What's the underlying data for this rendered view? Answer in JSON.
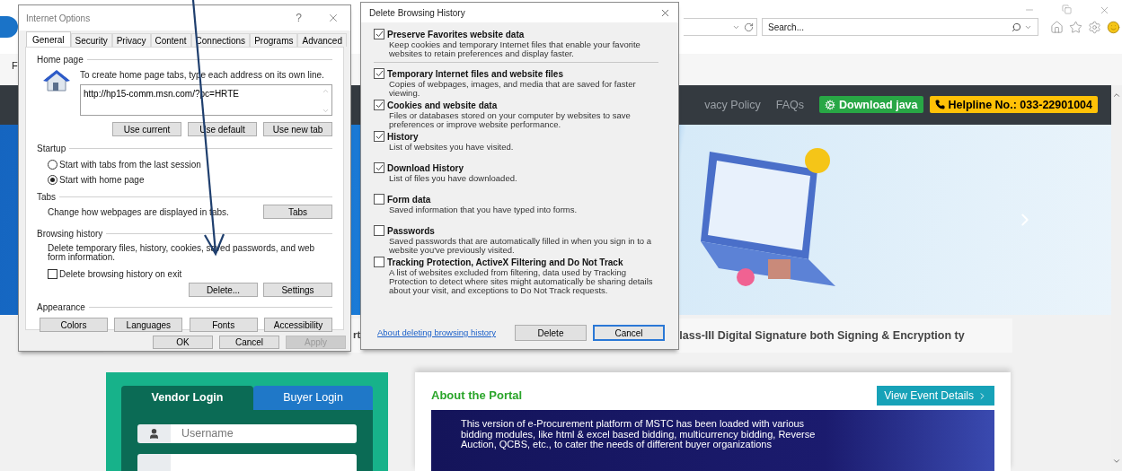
{
  "browser": {
    "search": {
      "placeholder": "Search..."
    },
    "menu_fragment": "F",
    "nav": {
      "links": [
        "vacy Policy",
        "FAQs"
      ],
      "buttons": [
        {
          "kind": "java",
          "label": "Download java"
        },
        {
          "kind": "helpline",
          "label": "Helpline No.: 033-22901004"
        }
      ]
    },
    "marquee": {
      "left": "rt",
      "right": "lass-III Digital Signature both Signing & Encryption ty"
    },
    "login": {
      "tabs": [
        {
          "label": "Vendor Login",
          "selected": true
        },
        {
          "label": "Buyer Login",
          "selected": false
        }
      ],
      "username": {
        "placeholder": "Username"
      }
    },
    "about": {
      "title": "About the Portal",
      "button": "View Event Details",
      "text": "This version of e-Procurement platform of MSTC has been loaded with various bidding modules, like html & excel based bidding, multicurrency bidding, Reverse Auction, QCBS, etc., to cater the needs of different buyer organizations"
    }
  },
  "internet_options": {
    "title": "Internet Options",
    "help": "?",
    "tabs": [
      {
        "label": "General",
        "selected": true
      },
      {
        "label": "Security",
        "selected": false
      },
      {
        "label": "Privacy",
        "selected": false
      },
      {
        "label": "Content",
        "selected": false
      },
      {
        "label": "Connections",
        "selected": false
      },
      {
        "label": "Programs",
        "selected": false
      },
      {
        "label": "Advanced",
        "selected": false
      }
    ],
    "home_page": {
      "label": "Home page",
      "instruction": "To create home page tabs, type each address on its own line.",
      "url": "http://hp15-comm.msn.com/?pc=HRTE",
      "buttons": [
        "Use current",
        "Use default",
        "Use new tab"
      ]
    },
    "startup": {
      "label": "Startup",
      "options": [
        {
          "label": "Start with tabs from the last session",
          "selected": false
        },
        {
          "label": "Start with home page",
          "selected": true
        }
      ]
    },
    "tabs_section": {
      "label": "Tabs",
      "text": "Change how webpages are displayed in tabs.",
      "button": "Tabs"
    },
    "browsing_history": {
      "label": "Browsing history",
      "text": "Delete temporary files, history, cookies, saved passwords, and web form information.",
      "checkbox": {
        "label": "Delete browsing history on exit",
        "checked": false
      },
      "buttons": [
        "Delete...",
        "Settings"
      ]
    },
    "appearance": {
      "label": "Appearance",
      "buttons": [
        "Colors",
        "Languages",
        "Fonts",
        "Accessibility"
      ]
    },
    "footer": [
      {
        "label": "OK",
        "disabled": false
      },
      {
        "label": "Cancel",
        "disabled": false
      },
      {
        "label": "Apply",
        "disabled": true
      }
    ]
  },
  "delete_history": {
    "title": "Delete Browsing History",
    "items": [
      {
        "title": "Preserve Favorites website data",
        "description": "Keep cookies and temporary Internet files that enable your favorite websites to retain preferences and display faster.",
        "checked": true
      },
      {
        "title": "Temporary Internet files and website files",
        "description": "Copies of webpages, images, and media that are saved for faster viewing.",
        "checked": true
      },
      {
        "title": "Cookies and website data",
        "description": "Files or databases stored on your computer by websites to save preferences or improve website performance.",
        "checked": true
      },
      {
        "title": "History",
        "description": "List of websites you have visited.",
        "checked": true
      },
      {
        "title": "Download History",
        "description": "List of files you have downloaded.",
        "checked": true
      },
      {
        "title": "Form data",
        "description": "Saved information that you have typed into forms.",
        "checked": false
      },
      {
        "title": "Passwords",
        "description": "Saved passwords that are automatically filled in when you sign in to a website you've previously visited.",
        "checked": false
      },
      {
        "title": "Tracking Protection, ActiveX Filtering and Do Not Track",
        "description": "A list of websites excluded from filtering, data used by Tracking Protection to detect where sites might automatically be sharing details about your visit, and exceptions to Do Not Track requests.",
        "checked": false
      }
    ],
    "link": "About deleting browsing history",
    "buttons": [
      {
        "label": "Delete",
        "focused": false
      },
      {
        "label": "Cancel",
        "focused": true
      }
    ]
  }
}
